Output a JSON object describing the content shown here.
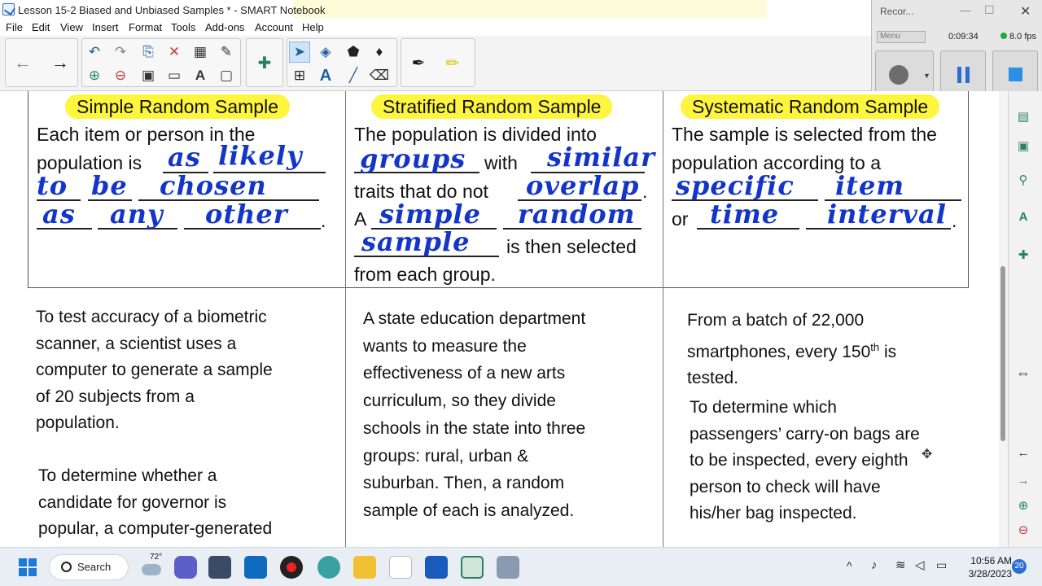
{
  "window": {
    "title": "Lesson 15-2 Biased and Unbiased Samples * - SMART Notebook"
  },
  "menu": [
    "File",
    "Edit",
    "View",
    "Insert",
    "Format",
    "Tools",
    "Add-ons",
    "Account",
    "Help"
  ],
  "recorder": {
    "title": "Recor...",
    "menu_label": "Menu",
    "time": "0:09:34",
    "fps": "8.0 fps"
  },
  "table": {
    "columns": [
      {
        "header": "Simple Random Sample",
        "lines": [
          "Each item or person in the",
          "population is"
        ],
        "handwriting": [
          "as",
          "likely",
          "to",
          "be",
          "chosen",
          "as",
          "any",
          "other"
        ],
        "end_mark": "."
      },
      {
        "header": "Stratified Random Sample",
        "line1": "The population is divided into",
        "with": "with",
        "traits": "traits that do not",
        "a": "A",
        "selected": "is then selected",
        "from": "from each group.",
        "handwriting": [
          "groups",
          "similar",
          "overlap",
          "simple",
          "random",
          "sample"
        ],
        "end_mark": "."
      },
      {
        "header": "Systematic Random Sample",
        "line1": "The sample is selected from the",
        "line2": "population according to a",
        "or": "or",
        "handwriting": [
          "specific",
          "item",
          "time",
          "interval"
        ],
        "end_mark": "."
      }
    ]
  },
  "examples": {
    "ex1": [
      "To test accuracy of a biometric",
      "scanner, a scientist uses a",
      "computer to generate a sample",
      "of 20 subjects from a",
      "population."
    ],
    "ex2": [
      "To determine whether a",
      "candidate for governor is",
      "popular, a computer-generated"
    ],
    "ex3": [
      "A state education department",
      "wants to measure the",
      "effectiveness of a new arts",
      "curriculum, so they divide",
      "schools in the state into three",
      "groups: rural, urban &",
      "suburban.  Then, a random",
      "sample of each is analyzed."
    ],
    "ex4_pre": "From a batch of 22,000",
    "ex4_l2": "smartphones, every 150",
    "ex4_sup": "th",
    "ex4_l2b": " is",
    "ex4_l3": "tested.",
    "ex5": [
      "To determine which",
      "passengers’ carry-on bags are",
      "to be inspected, every eighth",
      "person to check will have",
      "his/her bag inspected."
    ]
  },
  "taskbar": {
    "weather": "72°",
    "search": "Search",
    "time": "10:56 AM",
    "date": "3/28/2023",
    "badge": "20"
  }
}
